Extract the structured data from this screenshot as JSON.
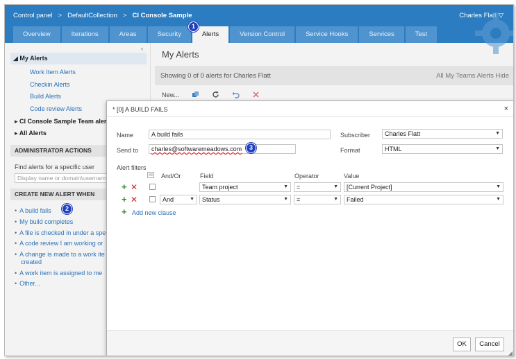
{
  "breadcrumb": {
    "item1": "Control panel",
    "sep": ">",
    "item2": "DefaultCollection",
    "item3": "CI Console Sample"
  },
  "user": {
    "name": "Charles Flatt ▽"
  },
  "tabs": [
    {
      "label": "Overview"
    },
    {
      "label": "Iterations"
    },
    {
      "label": "Areas"
    },
    {
      "label": "Security"
    },
    {
      "label": "Alerts"
    },
    {
      "label": "Version Control"
    },
    {
      "label": "Service Hooks"
    },
    {
      "label": "Services"
    },
    {
      "label": "Test"
    }
  ],
  "badges": {
    "b1": "1",
    "b2": "2",
    "b3": "3"
  },
  "sidebar": {
    "collapse": "‹",
    "my_alerts": "My Alerts",
    "sub": [
      "Work Item Alerts",
      "Checkin Alerts",
      "Build Alerts",
      "Code review Alerts"
    ],
    "team_alerts": "CI Console Sample Team aler",
    "all_alerts": "All Alerts",
    "admin_header": "ADMINISTRATOR ACTIONS",
    "find_label": "Find alerts for a specific user",
    "find_placeholder": "Display name or domain\\usernam",
    "create_header": "CREATE NEW ALERT WHEN",
    "create_items": [
      "A build fails",
      "My build completes",
      "A file is checked in under a spe",
      "A code review I am working or",
      "A change is made to a work ite",
      "created",
      "A work item is assigned to me",
      "Other..."
    ]
  },
  "main": {
    "title": "My Alerts",
    "showing": "Showing 0 of 0 alerts for Charles Flatt",
    "right_links": "All My Teams Alerts  Hide",
    "toolbar_new": "New..."
  },
  "dialog": {
    "title": "* [0] A BUILD FAILS",
    "close": "×",
    "name_label": "Name",
    "name_value": "A build fails",
    "sendto_label": "Send to",
    "sendto_value": "charles@softwaremeadows.com",
    "subscriber_label": "Subscriber",
    "subscriber_value": "Charles Flatt",
    "format_label": "Format",
    "format_value": "HTML",
    "filters_label": "Alert filters",
    "col_andor": "And/Or",
    "col_field": "Field",
    "col_operator": "Operator",
    "col_value": "Value",
    "row1": {
      "andor": "",
      "field": "Team project",
      "operator": "=",
      "value": "[Current Project]"
    },
    "row2": {
      "andor": "And",
      "field": "Status",
      "operator": "=",
      "value": "Failed"
    },
    "add_clause": "Add new clause",
    "ok": "OK",
    "cancel": "Cancel"
  }
}
